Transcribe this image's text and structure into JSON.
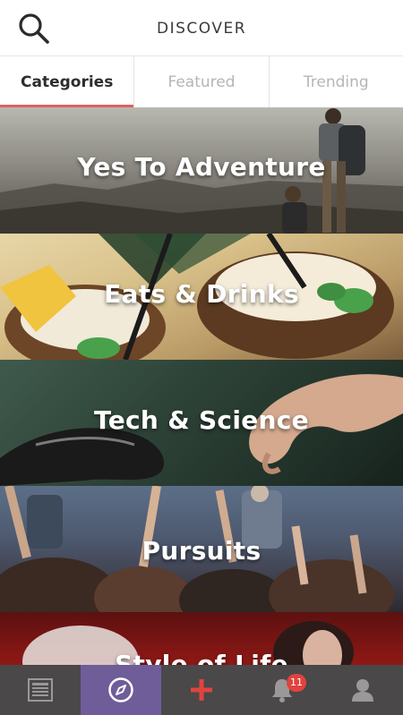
{
  "header": {
    "title": "DISCOVER",
    "search_icon": "search-icon"
  },
  "tabs": [
    {
      "label": "Categories",
      "active": true
    },
    {
      "label": "Featured",
      "active": false
    },
    {
      "label": "Trending",
      "active": false
    }
  ],
  "categories": [
    {
      "label": "Yes To Adventure"
    },
    {
      "label": "Eats & Drinks"
    },
    {
      "label": "Tech & Science"
    },
    {
      "label": "Pursuits"
    },
    {
      "label": "Style of Life"
    }
  ],
  "bottom_nav": {
    "items": [
      {
        "icon": "feed-icon"
      },
      {
        "icon": "compass-icon",
        "active": true
      },
      {
        "icon": "plus-icon"
      },
      {
        "icon": "bell-icon",
        "badge": "11"
      },
      {
        "icon": "profile-icon"
      }
    ]
  },
  "colors": {
    "tab_underline": "#e0605b",
    "nav_bg": "#4a4849",
    "nav_active": "#6e5d99",
    "plus": "#e0433e",
    "badge": "#e0433e"
  }
}
